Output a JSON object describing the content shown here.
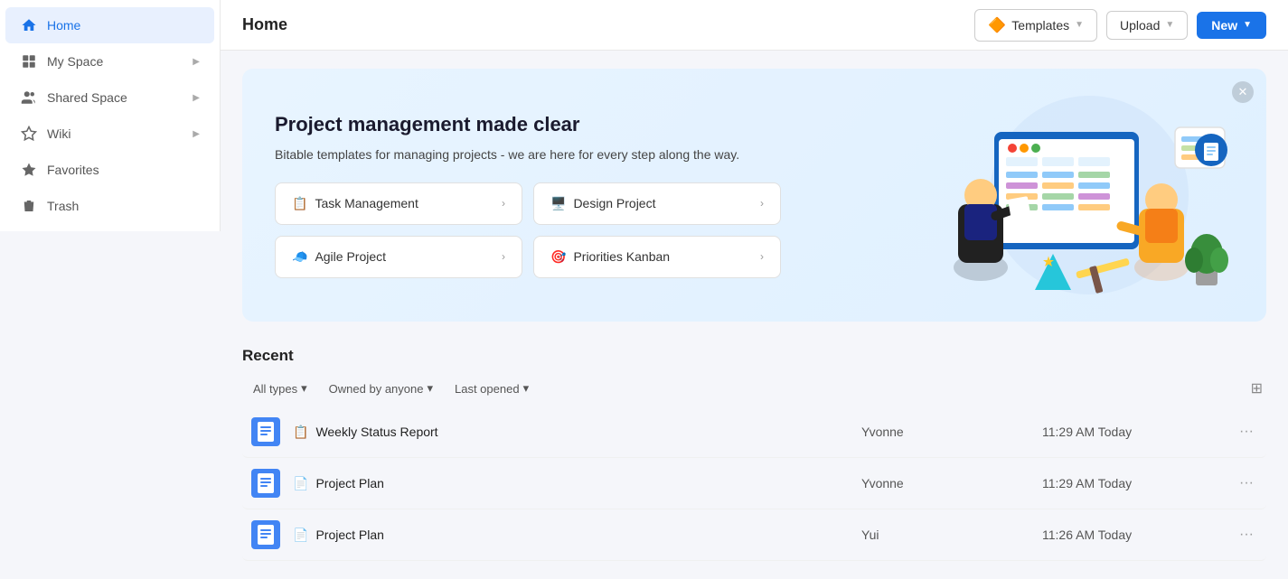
{
  "sidebar": {
    "items": [
      {
        "id": "home",
        "label": "Home",
        "icon": "🏠",
        "active": true,
        "expandable": false
      },
      {
        "id": "my-space",
        "label": "My Space",
        "icon": "👤",
        "active": false,
        "expandable": true
      },
      {
        "id": "shared-space",
        "label": "Shared Space",
        "icon": "👥",
        "active": false,
        "expandable": true
      },
      {
        "id": "wiki",
        "label": "Wiki",
        "icon": "📋",
        "active": false,
        "expandable": true
      },
      {
        "id": "favorites",
        "label": "Favorites",
        "icon": "⭐",
        "active": false,
        "expandable": false
      },
      {
        "id": "trash",
        "label": "Trash",
        "icon": "🗑️",
        "active": false,
        "expandable": false
      }
    ]
  },
  "header": {
    "title": "Home",
    "buttons": {
      "templates_label": "Templates",
      "upload_label": "Upload",
      "new_label": "New"
    }
  },
  "banner": {
    "heading": "Project management made clear",
    "subtext": "Bitable templates for managing projects - we are here for every step along the way.",
    "cards": [
      {
        "id": "task-management",
        "emoji": "📋",
        "label": "Task Management"
      },
      {
        "id": "design-project",
        "emoji": "🖥️",
        "label": "Design Project"
      },
      {
        "id": "agile-project",
        "emoji": "🧢",
        "label": "Agile Project"
      },
      {
        "id": "priorities-kanban",
        "emoji": "🎯",
        "label": "Priorities Kanban"
      }
    ]
  },
  "recent": {
    "title": "Recent",
    "filters": {
      "type_label": "All types",
      "owner_label": "Owned by anyone",
      "date_label": "Last opened"
    },
    "rows": [
      {
        "id": 1,
        "prefix_emoji": "📋",
        "name": "Weekly Status Report",
        "owner": "Yvonne",
        "date": "11:29 AM Today"
      },
      {
        "id": 2,
        "prefix_emoji": "📄",
        "name": "Project Plan",
        "owner": "Yvonne",
        "date": "11:29 AM Today"
      },
      {
        "id": 3,
        "prefix_emoji": "📄",
        "name": "Project Plan",
        "owner": "Yui",
        "date": "11:26 AM Today"
      }
    ]
  }
}
